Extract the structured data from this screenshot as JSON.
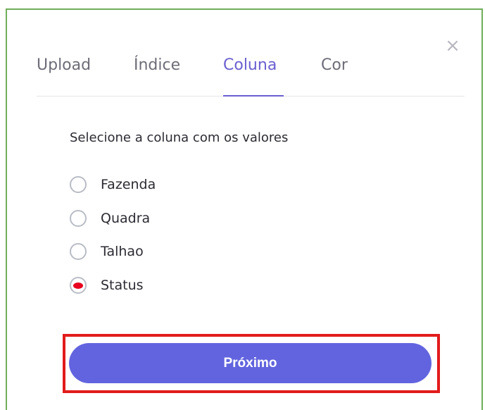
{
  "modal": {
    "close_glyph": "×"
  },
  "tabs": [
    {
      "label": "Upload",
      "active": false
    },
    {
      "label": "Índice",
      "active": false
    },
    {
      "label": "Coluna",
      "active": true
    },
    {
      "label": "Cor",
      "active": false
    }
  ],
  "content": {
    "prompt": "Selecione a coluna com os valores",
    "options": [
      {
        "label": "Fazenda",
        "selected": false
      },
      {
        "label": "Quadra",
        "selected": false
      },
      {
        "label": "Talhao",
        "selected": false
      },
      {
        "label": "Status",
        "selected": true
      }
    ]
  },
  "footer": {
    "next_label": "Próximo"
  },
  "colors": {
    "accent": "#6264df",
    "tab_active": "#6a5fd0",
    "selected_radio_dot": "#e8001f",
    "highlight_border": "#e21b1b",
    "modal_border": "#6fae5a"
  }
}
